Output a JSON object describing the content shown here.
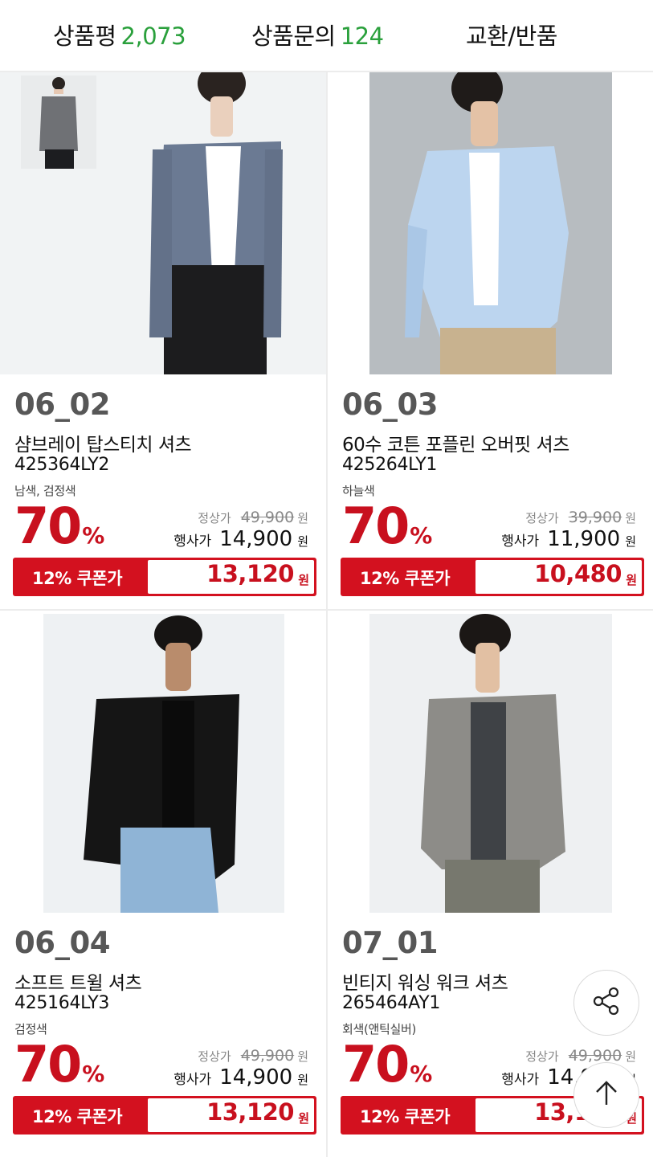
{
  "tabs": [
    {
      "label": "상품평",
      "count": "2,073"
    },
    {
      "label": "상품문의",
      "count": "124"
    },
    {
      "label": "교환/반품"
    }
  ],
  "colors": {
    "discount_red": "#c8101e",
    "count_green": "#2aa03c"
  },
  "products": [
    {
      "code": "06_02",
      "name": "샴브레이 탑스티치 셔츠",
      "sku": "425364LY2",
      "color": "남색, 검정색",
      "discount": "70",
      "discount_unit": "%",
      "regular_label": "정상가",
      "regular_price": "49,900",
      "sale_label": "행사가",
      "sale_price": "14,900",
      "currency": "원",
      "coupon_label": "12% 쿠폰가",
      "coupon_price": "13,120"
    },
    {
      "code": "06_03",
      "name": "60수 코튼 포플린 오버핏 셔츠",
      "sku": "425264LY1",
      "color": "하늘색",
      "discount": "70",
      "discount_unit": "%",
      "regular_label": "정상가",
      "regular_price": "39,900",
      "sale_label": "행사가",
      "sale_price": "11,900",
      "currency": "원",
      "coupon_label": "12% 쿠폰가",
      "coupon_price": "10,480"
    },
    {
      "code": "06_04",
      "name": "소프트 트윌 셔츠",
      "sku": "425164LY3",
      "color": "검정색",
      "discount": "70",
      "discount_unit": "%",
      "regular_label": "정상가",
      "regular_price": "49,900",
      "sale_label": "행사가",
      "sale_price": "14,900",
      "currency": "원",
      "coupon_label": "12% 쿠폰가",
      "coupon_price": "13,120"
    },
    {
      "code": "07_01",
      "name": "빈티지 워싱 워크 셔츠",
      "sku": "265464AY1",
      "color": "회색(앤틱실버)",
      "discount": "70",
      "discount_unit": "%",
      "regular_label": "정상가",
      "regular_price": "49,900",
      "sale_label": "행사가",
      "sale_price": "14,900",
      "currency": "원",
      "coupon_label": "12% 쿠폰가",
      "coupon_price": "13,120"
    }
  ],
  "floating": {
    "share_icon": "share-icon",
    "top_icon": "arrow-up-icon"
  }
}
